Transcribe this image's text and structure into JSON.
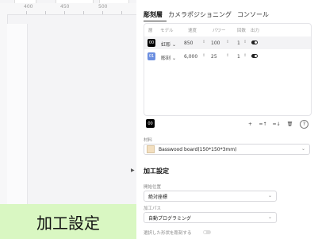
{
  "canvas": {
    "ruler_labels": [
      "400",
      "450",
      "500"
    ],
    "banner_text": "加工設定"
  },
  "tabs": [
    {
      "label": "彫刻層",
      "active": true
    },
    {
      "label": "カメラポジショニング",
      "active": false
    },
    {
      "label": "コンソール",
      "active": false
    }
  ],
  "layers": {
    "columns": [
      "層",
      "モデル",
      "速度",
      "パワー",
      "回数",
      "出力"
    ],
    "rows": [
      {
        "chip_label": "00",
        "chip_color": "#000000",
        "mode": "虹彫",
        "speed": "850",
        "power": "100",
        "passes": "1",
        "output": true
      },
      {
        "chip_label": "01",
        "chip_color": "#6c8fe0",
        "mode": "彫刻",
        "speed": "6,000",
        "power": "25",
        "passes": "1",
        "output": true
      }
    ]
  },
  "bottom_chip_label": "00",
  "toolbar_icons": [
    "plus-icon",
    "move-up-icon",
    "move-down-icon",
    "trash-icon",
    "help-icon"
  ],
  "material": {
    "label": "材料",
    "value": "Basswood board(150*150*3mm)",
    "swatch_color": "#f3dfbf"
  },
  "process": {
    "title": "加工設定",
    "start_label": "開始位置",
    "start_value": "絶対座標",
    "path_label": "加工パス",
    "path_value": "自動プログラミング",
    "engrave_selected_label": "選択した形状を彫刻する",
    "engrave_selected_on": false
  }
}
